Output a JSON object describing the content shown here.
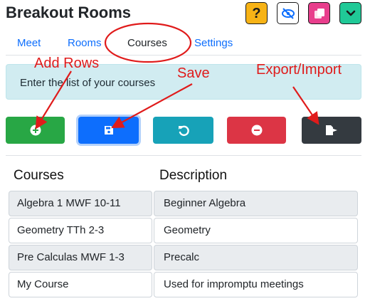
{
  "app": {
    "title": "Breakout Rooms"
  },
  "top_buttons": [
    {
      "icon": "question-icon",
      "glyph": "?",
      "color": "#f7b316"
    },
    {
      "icon": "eye-slash-icon",
      "color": "#ffffff"
    },
    {
      "icon": "copy-icon",
      "color": "#e83e8c"
    },
    {
      "icon": "chevron-down-icon",
      "color": "#20c997"
    }
  ],
  "tabs": [
    {
      "label": "Meet",
      "active": false
    },
    {
      "label": "Rooms",
      "active": false
    },
    {
      "label": "Courses",
      "active": true
    },
    {
      "label": "Settings",
      "active": false
    }
  ],
  "alert": {
    "text": "Enter the list of your courses"
  },
  "actions": [
    {
      "icon": "plus-circle-icon",
      "color": "#28a745"
    },
    {
      "icon": "save-icon",
      "color": "#0d6efd"
    },
    {
      "icon": "undo-icon",
      "color": "#17a2b8"
    },
    {
      "icon": "minus-circle-icon",
      "color": "#dc3545"
    },
    {
      "icon": "file-export-icon",
      "color": "#343a40"
    }
  ],
  "table": {
    "headers": [
      "Courses",
      "Description"
    ],
    "rows": [
      {
        "course": "Algebra 1 MWF 10-11",
        "description": "Beginner Algebra"
      },
      {
        "course": "Geometry TTh 2-3",
        "description": "Geometry"
      },
      {
        "course": "Pre Calculas MWF 1-3",
        "description": "Precalc"
      },
      {
        "course": "My Course",
        "description": "Used for impromptu meetings"
      }
    ]
  },
  "annotations": {
    "add_rows": "Add Rows",
    "save": "Save",
    "export_import": "Export/Import",
    "color": "#e01b1b"
  }
}
